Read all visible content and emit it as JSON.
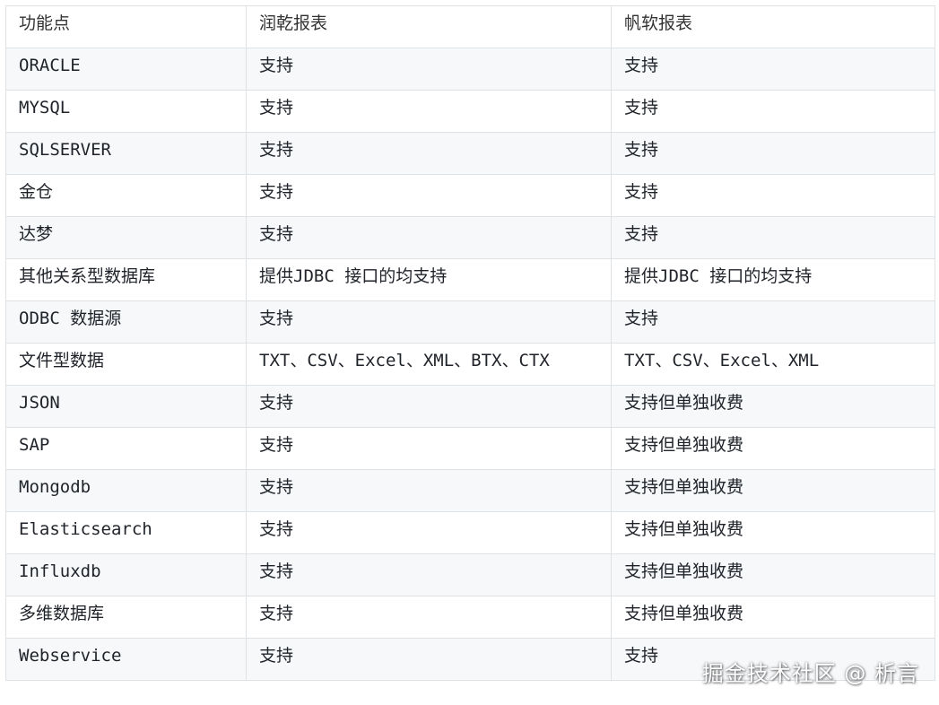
{
  "table": {
    "headers": [
      "功能点",
      "润乾报表",
      "帆软报表"
    ],
    "rows": [
      [
        "ORACLE",
        "支持",
        "支持"
      ],
      [
        "MYSQL",
        "支持",
        "支持"
      ],
      [
        "SQLSERVER",
        "支持",
        "支持"
      ],
      [
        "金仓",
        "支持",
        "支持"
      ],
      [
        "达梦",
        "支持",
        "支持"
      ],
      [
        "其他关系型数据库",
        "提供JDBC 接口的均支持",
        "提供JDBC 接口的均支持"
      ],
      [
        "ODBC 数据源",
        "支持",
        "支持"
      ],
      [
        "文件型数据",
        "TXT、CSV、Excel、XML、BTX、CTX",
        "TXT、CSV、Excel、XML"
      ],
      [
        "JSON",
        "支持",
        "支持但单独收费"
      ],
      [
        "SAP",
        "支持",
        "支持但单独收费"
      ],
      [
        "Mongodb",
        "支持",
        "支持但单独收费"
      ],
      [
        "Elasticsearch",
        "支持",
        "支持但单独收费"
      ],
      [
        "Influxdb",
        "支持",
        "支持但单独收费"
      ],
      [
        "多维数据库",
        "支持",
        "支持但单独收费"
      ],
      [
        "Webservice",
        "支持",
        "支持"
      ]
    ]
  },
  "watermark": "掘金技术社区 @ 析言"
}
